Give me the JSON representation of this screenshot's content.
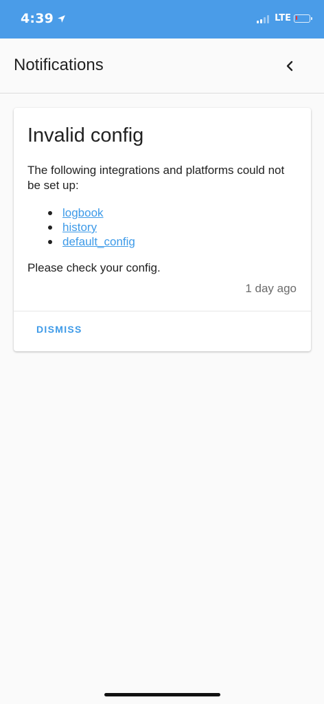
{
  "status_bar": {
    "time": "4:39",
    "network": "LTE",
    "battery_level": 0.1,
    "colors": {
      "background": "#4a9ce8",
      "battery_low": "#e53935"
    },
    "icons": [
      "location-arrow-icon",
      "cellular-signal-icon",
      "battery-icon"
    ]
  },
  "header": {
    "title": "Notifications",
    "back_icon": "chevron-left-icon"
  },
  "notification": {
    "title": "Invalid config",
    "message": "The following integrations and platforms could not be set up:",
    "items": [
      {
        "label": "logbook"
      },
      {
        "label": "history"
      },
      {
        "label": "default_config"
      }
    ],
    "footer": "Please check your config.",
    "timestamp": "1 day ago",
    "dismiss_label": "DISMISS"
  },
  "theme": {
    "accent": "#3d9ae8",
    "background": "#fafafa"
  }
}
